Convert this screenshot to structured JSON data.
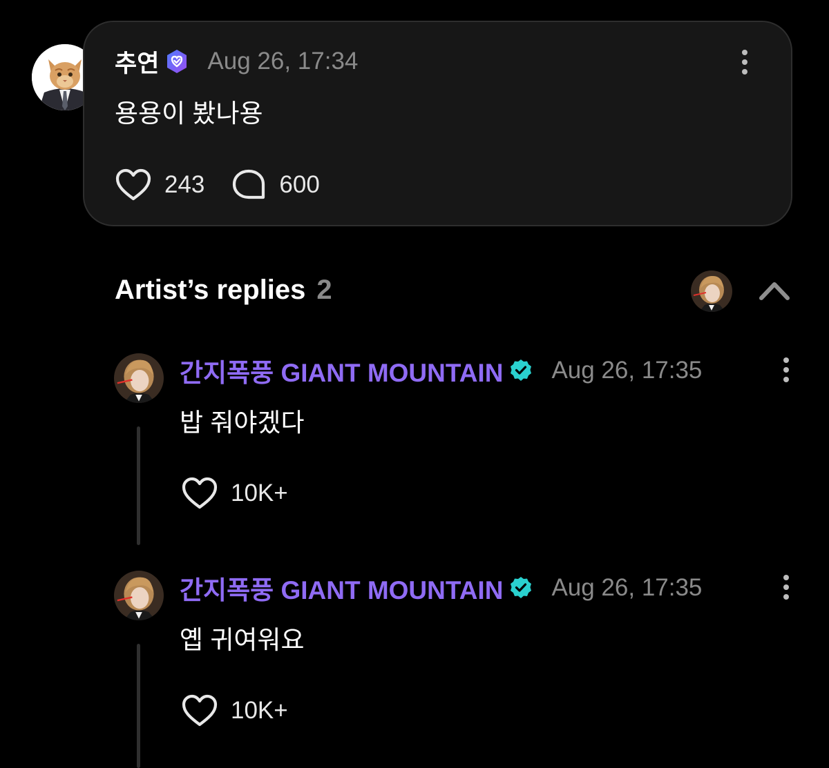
{
  "post": {
    "author": "추연",
    "timestamp": "Aug 26, 17:34",
    "body": "용용이 봤나용",
    "likes": "243",
    "comments": "600",
    "verified_icon": "fan-verified-badge",
    "more_icon": "more-vertical-icon"
  },
  "artist_replies": {
    "title": "Artist’s replies",
    "count": "2",
    "collapse_icon": "chevron-up-icon",
    "items": [
      {
        "author": "간지폭풍 GIANT MOUNTAIN",
        "timestamp": "Aug 26, 17:35",
        "body": "밥 줘야겠다",
        "likes": "10K+"
      },
      {
        "author": "간지폭풍 GIANT MOUNTAIN",
        "timestamp": "Aug 26, 17:35",
        "body": "옙 귀여워요",
        "likes": "10K+"
      }
    ]
  },
  "colors": {
    "background": "#000000",
    "card": "#171717",
    "artist_name": "#8f6bf4",
    "artist_badge": "#2ad1cf",
    "fan_badge": "#6d5cf5",
    "muted_text": "#8a8a8a"
  }
}
